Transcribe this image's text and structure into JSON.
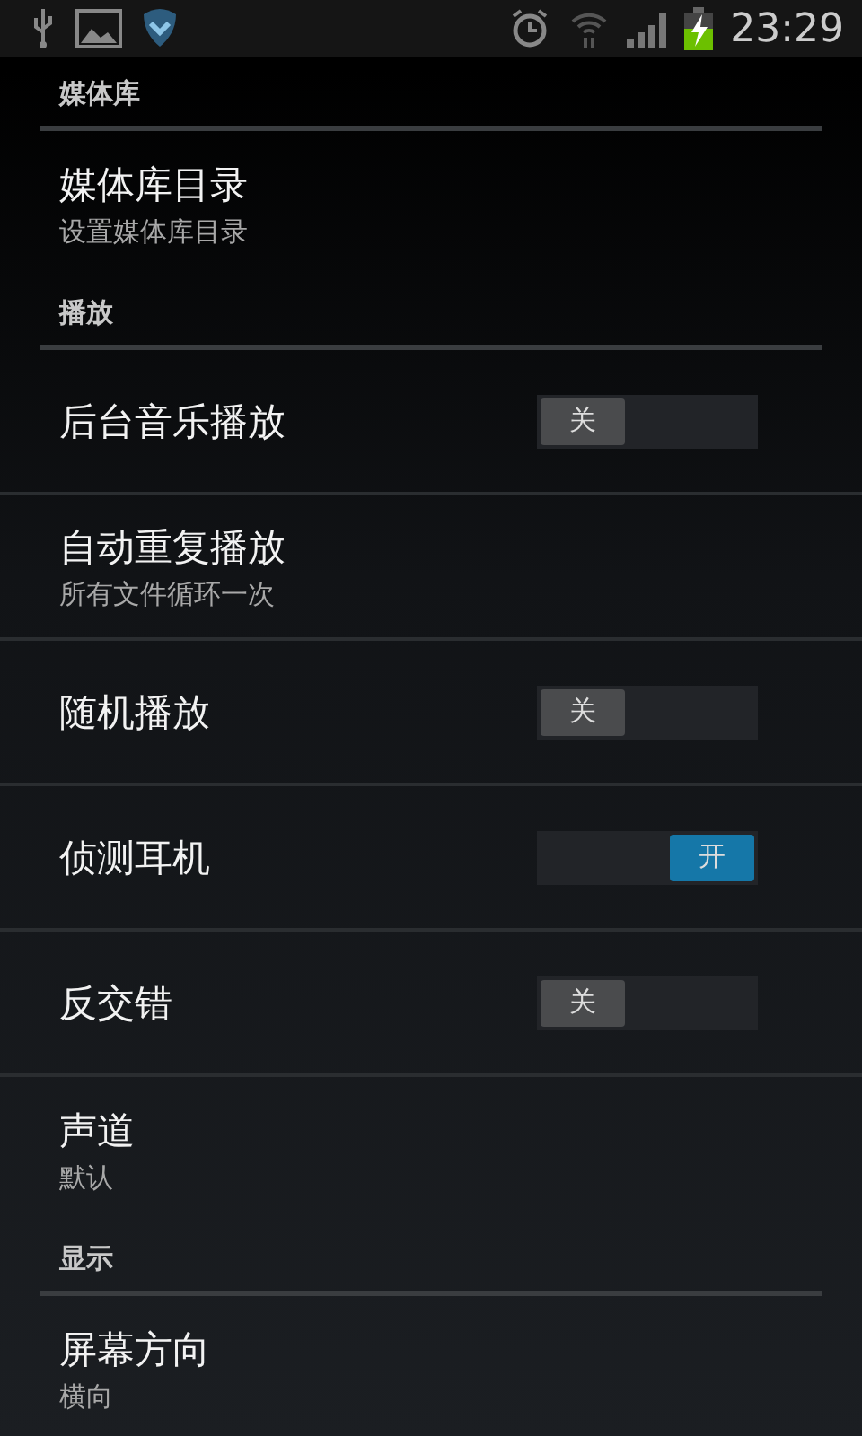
{
  "status_bar": {
    "time": "23:29"
  },
  "sections": [
    {
      "title": "媒体库",
      "items": [
        {
          "kind": "text",
          "title": "媒体库目录",
          "summary": "设置媒体库目录"
        }
      ]
    },
    {
      "title": "播放",
      "items": [
        {
          "kind": "toggle",
          "title": "后台音乐播放",
          "on": false,
          "switch_text": "关"
        },
        {
          "kind": "text",
          "title": "自动重复播放",
          "summary": "所有文件循环一次"
        },
        {
          "kind": "toggle",
          "title": "随机播放",
          "on": false,
          "switch_text": "关"
        },
        {
          "kind": "toggle",
          "title": "侦测耳机",
          "on": true,
          "switch_text": "开"
        },
        {
          "kind": "toggle",
          "title": "反交错",
          "on": false,
          "switch_text": "关"
        },
        {
          "kind": "text",
          "title": "声道",
          "summary": "默认"
        }
      ]
    },
    {
      "title": "显示",
      "items": [
        {
          "kind": "text",
          "title": "屏幕方向",
          "summary": "横向"
        }
      ]
    }
  ]
}
